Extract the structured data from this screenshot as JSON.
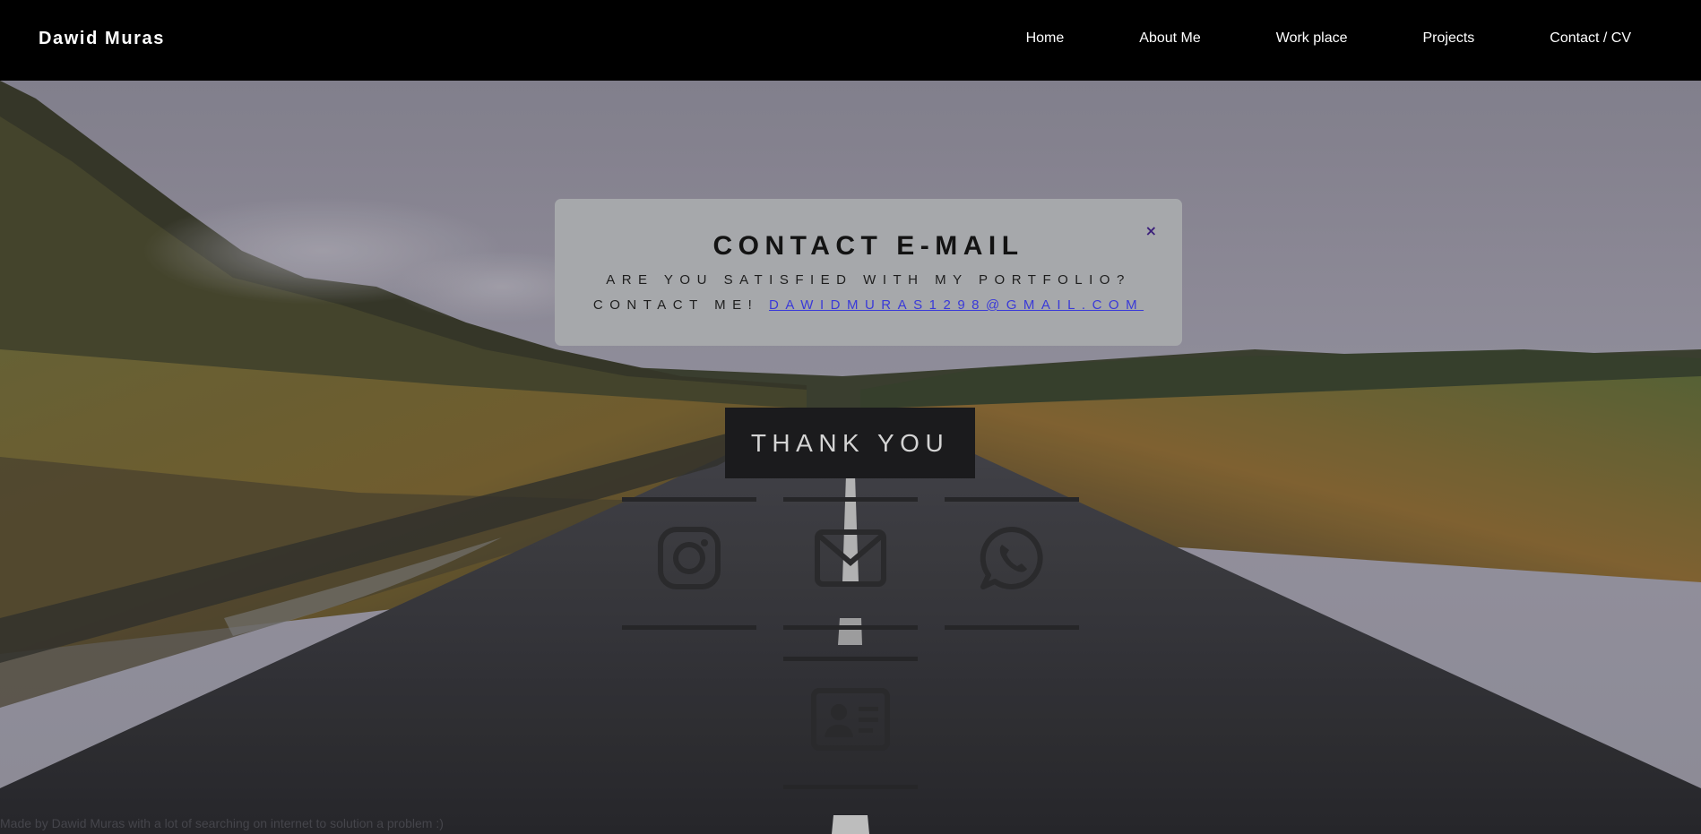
{
  "header": {
    "brand": "Dawid Muras",
    "nav": [
      {
        "label": "Home"
      },
      {
        "label": "About Me"
      },
      {
        "label": "Work place"
      },
      {
        "label": "Projects"
      },
      {
        "label": "Contact / CV"
      }
    ]
  },
  "popup": {
    "title": "CONTACT E-MAIL",
    "line1": "ARE YOU SATISFIED WITH MY PORTFOLIO?",
    "line2_prefix": "CONTACT ME!",
    "email": "DAWIDMURAS1298@GMAIL.COM",
    "close": "×"
  },
  "thanks": {
    "label": "THANK YOU"
  },
  "social": {
    "icons": [
      "instagram-icon",
      "mail-icon",
      "whatsapp-icon",
      "contact-card-icon"
    ]
  },
  "footer": {
    "note": "Made by Dawid Muras with a lot of searching on internet to solution a problem :)"
  },
  "colors": {
    "accent_link": "#3a3ad8",
    "close": "#3b1f7a",
    "popup_bg": "#a6a8ab"
  }
}
